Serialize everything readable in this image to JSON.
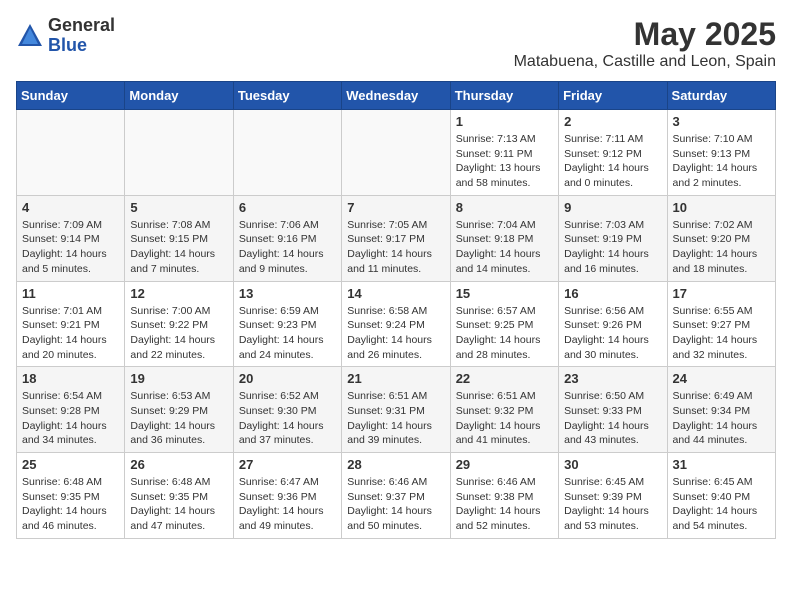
{
  "logo": {
    "general": "General",
    "blue": "Blue"
  },
  "title": "May 2025",
  "subtitle": "Matabuena, Castille and Leon, Spain",
  "days_of_week": [
    "Sunday",
    "Monday",
    "Tuesday",
    "Wednesday",
    "Thursday",
    "Friday",
    "Saturday"
  ],
  "weeks": [
    {
      "cells": [
        {
          "day": "",
          "empty": true
        },
        {
          "day": "",
          "empty": true
        },
        {
          "day": "",
          "empty": true
        },
        {
          "day": "",
          "empty": true
        },
        {
          "day": "1",
          "sunrise": "7:13 AM",
          "sunset": "9:11 PM",
          "daylight": "13 hours and 58 minutes."
        },
        {
          "day": "2",
          "sunrise": "7:11 AM",
          "sunset": "9:12 PM",
          "daylight": "14 hours and 0 minutes."
        },
        {
          "day": "3",
          "sunrise": "7:10 AM",
          "sunset": "9:13 PM",
          "daylight": "14 hours and 2 minutes."
        }
      ]
    },
    {
      "cells": [
        {
          "day": "4",
          "sunrise": "7:09 AM",
          "sunset": "9:14 PM",
          "daylight": "14 hours and 5 minutes."
        },
        {
          "day": "5",
          "sunrise": "7:08 AM",
          "sunset": "9:15 PM",
          "daylight": "14 hours and 7 minutes."
        },
        {
          "day": "6",
          "sunrise": "7:06 AM",
          "sunset": "9:16 PM",
          "daylight": "14 hours and 9 minutes."
        },
        {
          "day": "7",
          "sunrise": "7:05 AM",
          "sunset": "9:17 PM",
          "daylight": "14 hours and 11 minutes."
        },
        {
          "day": "8",
          "sunrise": "7:04 AM",
          "sunset": "9:18 PM",
          "daylight": "14 hours and 14 minutes."
        },
        {
          "day": "9",
          "sunrise": "7:03 AM",
          "sunset": "9:19 PM",
          "daylight": "14 hours and 16 minutes."
        },
        {
          "day": "10",
          "sunrise": "7:02 AM",
          "sunset": "9:20 PM",
          "daylight": "14 hours and 18 minutes."
        }
      ]
    },
    {
      "cells": [
        {
          "day": "11",
          "sunrise": "7:01 AM",
          "sunset": "9:21 PM",
          "daylight": "14 hours and 20 minutes."
        },
        {
          "day": "12",
          "sunrise": "7:00 AM",
          "sunset": "9:22 PM",
          "daylight": "14 hours and 22 minutes."
        },
        {
          "day": "13",
          "sunrise": "6:59 AM",
          "sunset": "9:23 PM",
          "daylight": "14 hours and 24 minutes."
        },
        {
          "day": "14",
          "sunrise": "6:58 AM",
          "sunset": "9:24 PM",
          "daylight": "14 hours and 26 minutes."
        },
        {
          "day": "15",
          "sunrise": "6:57 AM",
          "sunset": "9:25 PM",
          "daylight": "14 hours and 28 minutes."
        },
        {
          "day": "16",
          "sunrise": "6:56 AM",
          "sunset": "9:26 PM",
          "daylight": "14 hours and 30 minutes."
        },
        {
          "day": "17",
          "sunrise": "6:55 AM",
          "sunset": "9:27 PM",
          "daylight": "14 hours and 32 minutes."
        }
      ]
    },
    {
      "cells": [
        {
          "day": "18",
          "sunrise": "6:54 AM",
          "sunset": "9:28 PM",
          "daylight": "14 hours and 34 minutes."
        },
        {
          "day": "19",
          "sunrise": "6:53 AM",
          "sunset": "9:29 PM",
          "daylight": "14 hours and 36 minutes."
        },
        {
          "day": "20",
          "sunrise": "6:52 AM",
          "sunset": "9:30 PM",
          "daylight": "14 hours and 37 minutes."
        },
        {
          "day": "21",
          "sunrise": "6:51 AM",
          "sunset": "9:31 PM",
          "daylight": "14 hours and 39 minutes."
        },
        {
          "day": "22",
          "sunrise": "6:51 AM",
          "sunset": "9:32 PM",
          "daylight": "14 hours and 41 minutes."
        },
        {
          "day": "23",
          "sunrise": "6:50 AM",
          "sunset": "9:33 PM",
          "daylight": "14 hours and 43 minutes."
        },
        {
          "day": "24",
          "sunrise": "6:49 AM",
          "sunset": "9:34 PM",
          "daylight": "14 hours and 44 minutes."
        }
      ]
    },
    {
      "cells": [
        {
          "day": "25",
          "sunrise": "6:48 AM",
          "sunset": "9:35 PM",
          "daylight": "14 hours and 46 minutes."
        },
        {
          "day": "26",
          "sunrise": "6:48 AM",
          "sunset": "9:35 PM",
          "daylight": "14 hours and 47 minutes."
        },
        {
          "day": "27",
          "sunrise": "6:47 AM",
          "sunset": "9:36 PM",
          "daylight": "14 hours and 49 minutes."
        },
        {
          "day": "28",
          "sunrise": "6:46 AM",
          "sunset": "9:37 PM",
          "daylight": "14 hours and 50 minutes."
        },
        {
          "day": "29",
          "sunrise": "6:46 AM",
          "sunset": "9:38 PM",
          "daylight": "14 hours and 52 minutes."
        },
        {
          "day": "30",
          "sunrise": "6:45 AM",
          "sunset": "9:39 PM",
          "daylight": "14 hours and 53 minutes."
        },
        {
          "day": "31",
          "sunrise": "6:45 AM",
          "sunset": "9:40 PM",
          "daylight": "14 hours and 54 minutes."
        }
      ]
    }
  ],
  "labels": {
    "sunrise": "Sunrise:",
    "sunset": "Sunset:",
    "daylight": "Daylight:"
  }
}
